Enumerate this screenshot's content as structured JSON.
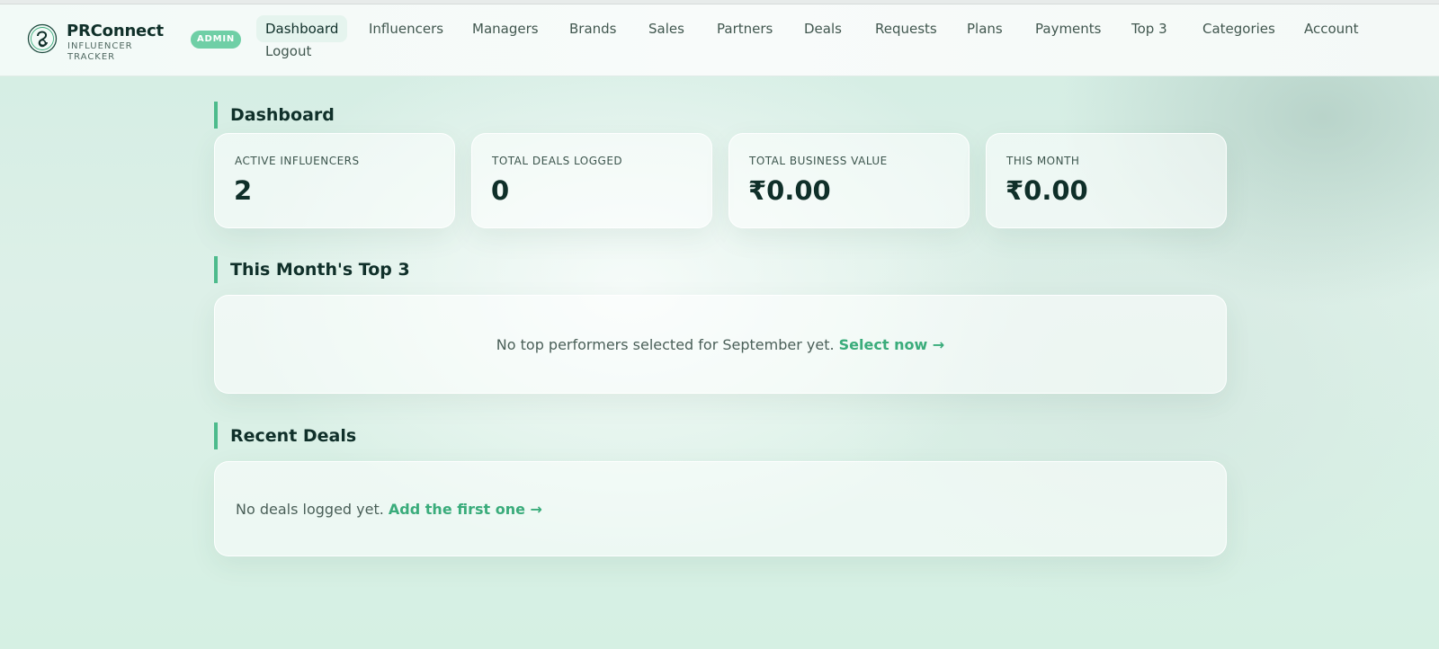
{
  "brand": {
    "name": "PRConnect",
    "subtitle": "INFLUENCER TRACKER",
    "role_badge": "ADMIN"
  },
  "nav": {
    "items": [
      {
        "label": "Dashboard",
        "active": true
      },
      {
        "label": "Influencers"
      },
      {
        "label": "Managers"
      },
      {
        "label": "Brands"
      },
      {
        "label": "Sales"
      },
      {
        "label": "Partners"
      },
      {
        "label": "Deals"
      },
      {
        "label": "Requests"
      },
      {
        "label": "Plans"
      },
      {
        "label": "Payments"
      },
      {
        "label": "Top 3"
      },
      {
        "label": "Categories"
      },
      {
        "label": "Account"
      },
      {
        "label": "Logout"
      }
    ]
  },
  "dashboard": {
    "title": "Dashboard",
    "stats": [
      {
        "label": "ACTIVE INFLUENCERS",
        "value": "2"
      },
      {
        "label": "TOTAL DEALS LOGGED",
        "value": "0"
      },
      {
        "label": "TOTAL BUSINESS VALUE",
        "value": "₹0.00"
      },
      {
        "label": "THIS MONTH",
        "value": "₹0.00"
      }
    ]
  },
  "top3": {
    "title": "This Month's Top 3",
    "empty_text": "No top performers selected for September yet.",
    "link_text": "Select now →"
  },
  "recent_deals": {
    "title": "Recent Deals",
    "empty_text": "No deals logged yet.",
    "link_text": "Add the first one →"
  },
  "colors": {
    "accent": "#4dbb8c",
    "link": "#3aac7b",
    "badge": "#6fcfa6",
    "heading": "#10302a"
  }
}
